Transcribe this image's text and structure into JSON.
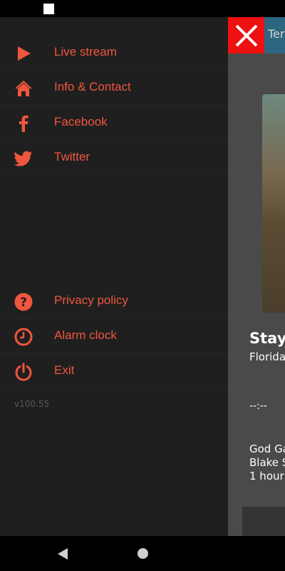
{
  "drawer": {
    "items_top": [
      {
        "label": "Live stream",
        "icon": "play-icon"
      },
      {
        "label": "Info & Contact",
        "icon": "home-icon"
      },
      {
        "label": "Facebook",
        "icon": "facebook-icon"
      },
      {
        "label": "Twitter",
        "icon": "twitter-icon"
      }
    ],
    "items_bottom": [
      {
        "label": "Privacy policy",
        "icon": "question-icon"
      },
      {
        "label": "Alarm clock",
        "icon": "clock-icon"
      },
      {
        "label": "Exit",
        "icon": "power-icon"
      }
    ],
    "version": "v100.55",
    "accent_color": "#f0563e"
  },
  "app": {
    "header_title": "Ter",
    "title": "Stay",
    "subtitle": "Florida",
    "time": "--:--",
    "artist_line1": "God Ga",
    "artist_line2": "Blake S",
    "artist_line3": "1 hour"
  }
}
